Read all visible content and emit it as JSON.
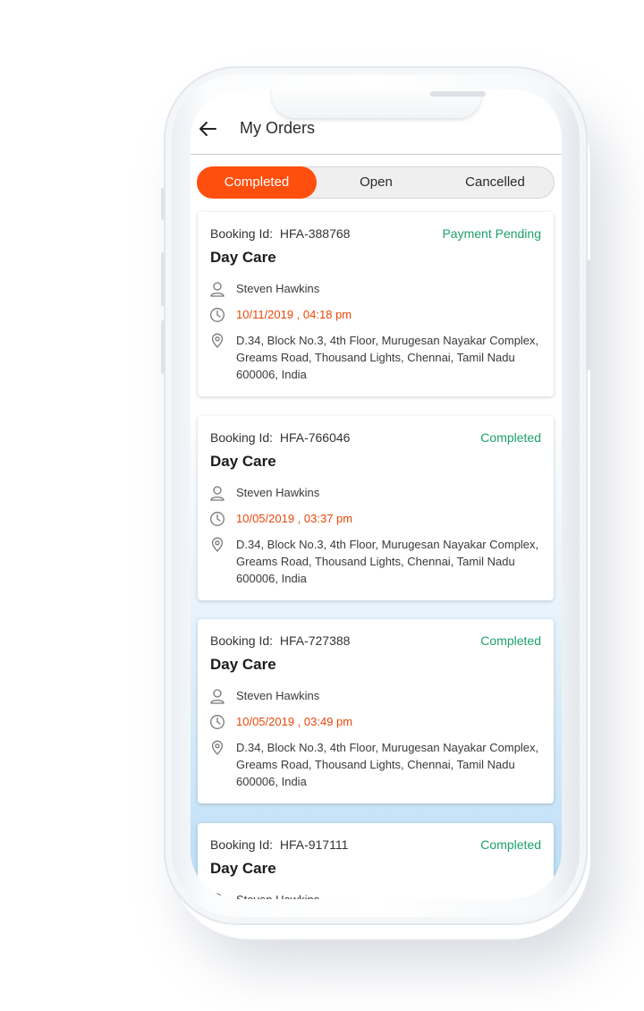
{
  "header": {
    "title": "My Orders",
    "back_icon": "arrow-left-icon"
  },
  "tabs": [
    {
      "label": "Completed",
      "active": true
    },
    {
      "label": "Open",
      "active": false
    },
    {
      "label": "Cancelled",
      "active": false
    }
  ],
  "orders": [
    {
      "booking_label": "Booking Id:",
      "booking_id": "HFA-388768",
      "status": "Payment Pending",
      "service": "Day Care",
      "customer": "Steven Hawkins",
      "datetime": "10/11/2019 , 04:18 pm",
      "address": "D.34, Block No.3, 4th Floor, Murugesan Nayakar Complex, Greams Road, Thousand Lights, Chennai, Tamil Nadu 600006, India"
    },
    {
      "booking_label": "Booking Id:",
      "booking_id": "HFA-766046",
      "status": "Completed",
      "service": "Day Care",
      "customer": "Steven Hawkins",
      "datetime": "10/05/2019 , 03:37 pm",
      "address": "D.34, Block No.3, 4th Floor, Murugesan Nayakar Complex, Greams Road, Thousand Lights, Chennai, Tamil Nadu 600006, India"
    },
    {
      "booking_label": "Booking Id:",
      "booking_id": "HFA-727388",
      "status": "Completed",
      "service": "Day Care",
      "customer": "Steven Hawkins",
      "datetime": "10/05/2019 , 03:49 pm",
      "address": "D.34, Block No.3, 4th Floor, Murugesan Nayakar Complex, Greams Road, Thousand Lights, Chennai, Tamil Nadu 600006, India"
    },
    {
      "booking_label": "Booking Id:",
      "booking_id": "HFA-917111",
      "status": "Completed",
      "service": "Day Care",
      "customer": "Steven Hawkins"
    }
  ],
  "colors": {
    "accent": "#ff4f0e",
    "status_green": "#1da06b",
    "time_orange": "#e8470a"
  },
  "icons": {
    "customer": "user-icon",
    "datetime": "clock-icon",
    "address": "location-pin-icon"
  }
}
